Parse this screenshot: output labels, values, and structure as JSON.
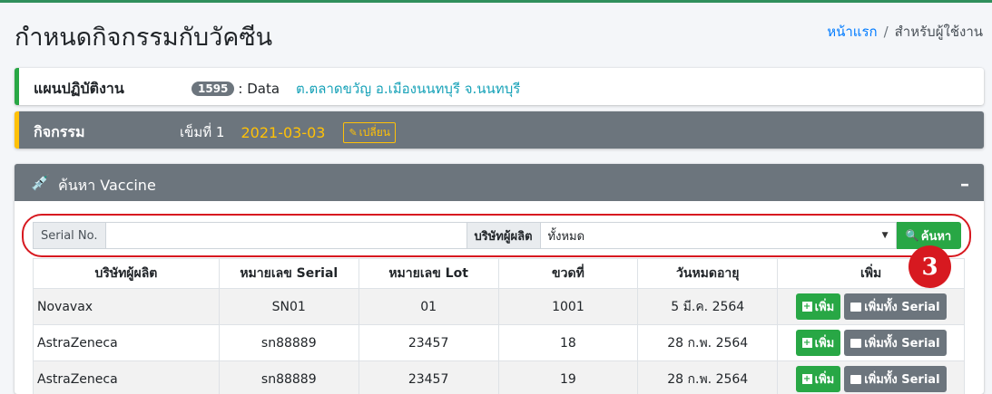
{
  "colors": {
    "accent_green": "#28a745",
    "accent_yellow": "#ffc107",
    "header_gray": "#6c757d",
    "link_blue": "#007bff",
    "location_teal": "#17a2b8",
    "highlight_red": "#d71920"
  },
  "header": {
    "title": "กำหนดกิจกรรมกับวัคซีน",
    "breadcrumb": {
      "home": "หน้าแรก",
      "separator": "/",
      "current": "สำหรับผู้ใช้งาน"
    }
  },
  "plan": {
    "label": "แผนปฏิบัติงาน",
    "count": "1595",
    "data": ": Data",
    "location": "ต.ตลาดขวัญ อ.เมืองนนทบุรี จ.นนทบุรี"
  },
  "activity": {
    "label": "กิจกรรม",
    "dose": "เข็มที่ 1",
    "date": "2021-03-03",
    "change_label": "เปลี่ยน",
    "change_icon": "pencil-icon"
  },
  "search": {
    "title": "ค้นหา Vaccine",
    "title_icon": "syringe-icon",
    "collapse_symbol": "–",
    "serial_label": "Serial No.",
    "serial_value": "",
    "maker_label": "บริษัทผู้ผลิต",
    "maker_selected": "ทั้งหมด",
    "button_label": "ค้นหา",
    "button_icon": "magnifier-icon"
  },
  "annotation": {
    "step_number": "3"
  },
  "table": {
    "columns": [
      "บริษัทผู้ผลิต",
      "หมายเลข Serial",
      "หมายเลข Lot",
      "ขวดที่",
      "วันหมดอายุ",
      "เพิ่ม"
    ],
    "rows": [
      {
        "maker": "Novavax",
        "serial": "SN01",
        "lot": "01",
        "vial": "1001",
        "expiry": "5 มี.ค. 2564"
      },
      {
        "maker": "AstraZeneca",
        "serial": "sn88889",
        "lot": "23457",
        "vial": "18",
        "expiry": "28 ก.พ. 2564"
      },
      {
        "maker": "AstraZeneca",
        "serial": "sn88889",
        "lot": "23457",
        "vial": "19",
        "expiry": "28 ก.พ. 2564"
      }
    ],
    "add_label": "เพิ่ม",
    "add_all_label": "เพิ่มทั้ง Serial"
  }
}
